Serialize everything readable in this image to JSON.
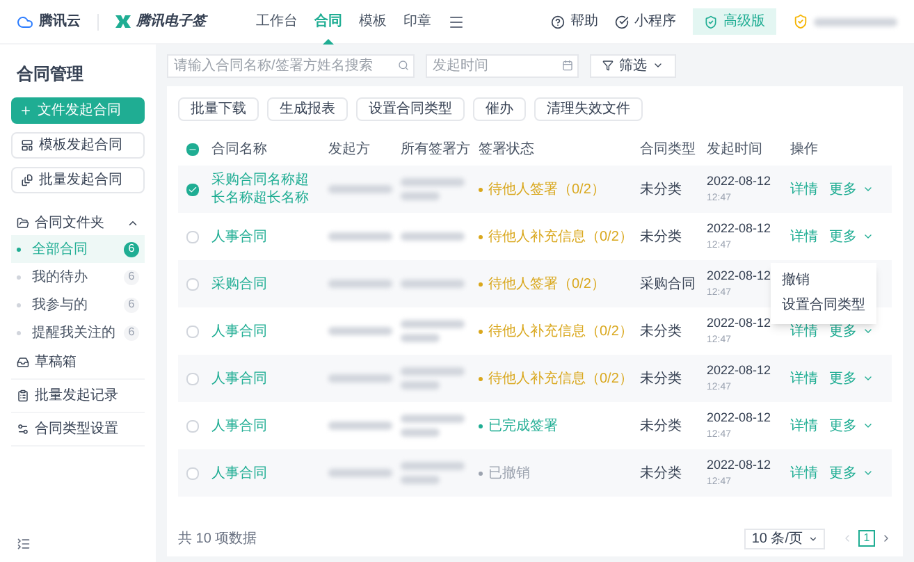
{
  "topbar": {
    "brand": "腾讯云",
    "product": "腾讯电子签",
    "nav": [
      {
        "label": "工作台",
        "selected": false
      },
      {
        "label": "合同",
        "selected": true
      },
      {
        "label": "模板",
        "selected": false
      },
      {
        "label": "印章",
        "selected": false
      }
    ],
    "help": "帮助",
    "mini_program": "小程序",
    "plan": "高级版"
  },
  "sidebar": {
    "title": "合同管理",
    "buttons": [
      {
        "label": "文件发起合同",
        "kind": "primary"
      },
      {
        "label": "模板发起合同",
        "kind": "template"
      },
      {
        "label": "批量发起合同",
        "kind": "batch"
      }
    ],
    "folder": {
      "label": "合同文件夹",
      "expanded": true,
      "children": [
        {
          "label": "全部合同",
          "count": "6",
          "selected": true
        },
        {
          "label": "我的待办",
          "count": "6",
          "selected": false
        },
        {
          "label": "我参与的",
          "count": "6",
          "selected": false
        },
        {
          "label": "提醒我关注的",
          "count": "6",
          "selected": false
        }
      ]
    },
    "items": [
      {
        "label": "草稿箱",
        "kind": "drafts"
      },
      {
        "label": "批量发起记录",
        "kind": "records"
      },
      {
        "label": "合同类型设置",
        "kind": "types"
      }
    ]
  },
  "filters": {
    "search": {
      "placeholder": "请输入合同名称/签署方姓名搜索"
    },
    "date": {
      "placeholder": "发起时间"
    },
    "filter": "筛选"
  },
  "toolbar": [
    "批量下载",
    "生成报表",
    "设置合同类型",
    "催办",
    "清理失效文件"
  ],
  "table": {
    "select_all_partial": true,
    "columns": [
      "合同名称",
      "发起方",
      "所有签署方",
      "签署状态",
      "合同类型",
      "发起时间",
      "操作"
    ],
    "rows": [
      {
        "checked": true,
        "name": "采购合同名称超长名称超长名称",
        "status": "待他人签署（0/2）",
        "color": "#d9a71c",
        "type": "未分类",
        "date": "2022-08-12",
        "time": "12:47",
        "actions": [
          "详情",
          "更多"
        ]
      },
      {
        "checked": false,
        "name": "人事合同",
        "status": "待他人补充信息（0/2）",
        "color": "#d9a71c",
        "type": "未分类",
        "date": "2022-08-12",
        "time": "12:47",
        "actions": [
          "详情",
          "更多"
        ],
        "menu": [
          "撤销",
          "设置合同类型"
        ]
      },
      {
        "checked": false,
        "name": "采购合同",
        "status": "待他人签署（0/2）",
        "color": "#d9a71c",
        "type": "采购合同",
        "date": "2022-08-12",
        "time": "12:47"
      },
      {
        "checked": false,
        "name": "人事合同",
        "status": "待他人补充信息（0/2）",
        "color": "#d9a71c",
        "type": "未分类",
        "date": "2022-08-12",
        "time": "12:47",
        "actions": [
          "详情",
          "更多"
        ]
      },
      {
        "checked": false,
        "name": "人事合同",
        "status": "待他人补充信息（0/2）",
        "color": "#d9a71c",
        "type": "未分类",
        "date": "2022-08-12",
        "time": "12:47",
        "actions": [
          "详情",
          "更多"
        ]
      },
      {
        "checked": false,
        "name": "人事合同",
        "status": "已完成签署",
        "color": "#1fad93",
        "type": "未分类",
        "date": "2022-08-12",
        "time": "12:47",
        "actions": [
          "详情",
          "更多"
        ]
      },
      {
        "checked": false,
        "name": "人事合同",
        "status": "已撤销",
        "color": "#9ca3af",
        "type": "未分类",
        "date": "2022-08-12",
        "time": "12:47",
        "actions": [
          "详情",
          "更多"
        ]
      }
    ]
  },
  "footer": {
    "total": "共 10 项数据",
    "page_size": "10 条/页",
    "pages": [
      {
        "label": "1",
        "selected": true
      }
    ]
  }
}
